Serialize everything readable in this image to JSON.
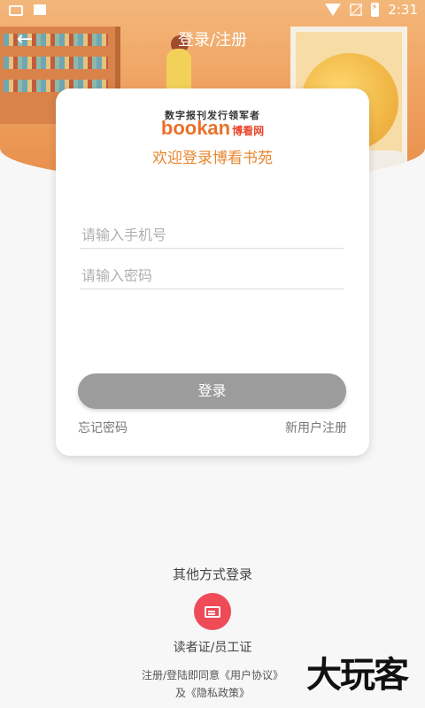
{
  "status_bar": {
    "time": "2:31",
    "icons": [
      "keyboard-icon",
      "image-icon",
      "wifi-icon",
      "no-signal-icon",
      "battery-charging-icon"
    ]
  },
  "header": {
    "title": "登录/注册",
    "back_icon": "←"
  },
  "card": {
    "slogan": "数字报刊发行领军者",
    "brand_latin": "bookan",
    "brand_cn": "博看网",
    "welcome": "欢迎登录博看书苑",
    "phone_placeholder": "请输入手机号",
    "password_placeholder": "请输入密码",
    "login_label": "登录",
    "forgot_label": "忘记密码",
    "register_label": "新用户注册"
  },
  "other_login": {
    "title": "其他方式登录",
    "card_login_label": "读者证/员工证",
    "card_icon": "id-card-icon"
  },
  "agreement": {
    "prefix": "注册/登陆即同意",
    "user_agreement": "《用户协议》",
    "conjunction": "及",
    "privacy_policy": "《隐私政策》"
  },
  "watermark": "大玩客",
  "colors": {
    "accent_orange": "#e8872f",
    "login_button": "#9c9c9c",
    "card_login_icon_bg": "#ee4a58"
  }
}
